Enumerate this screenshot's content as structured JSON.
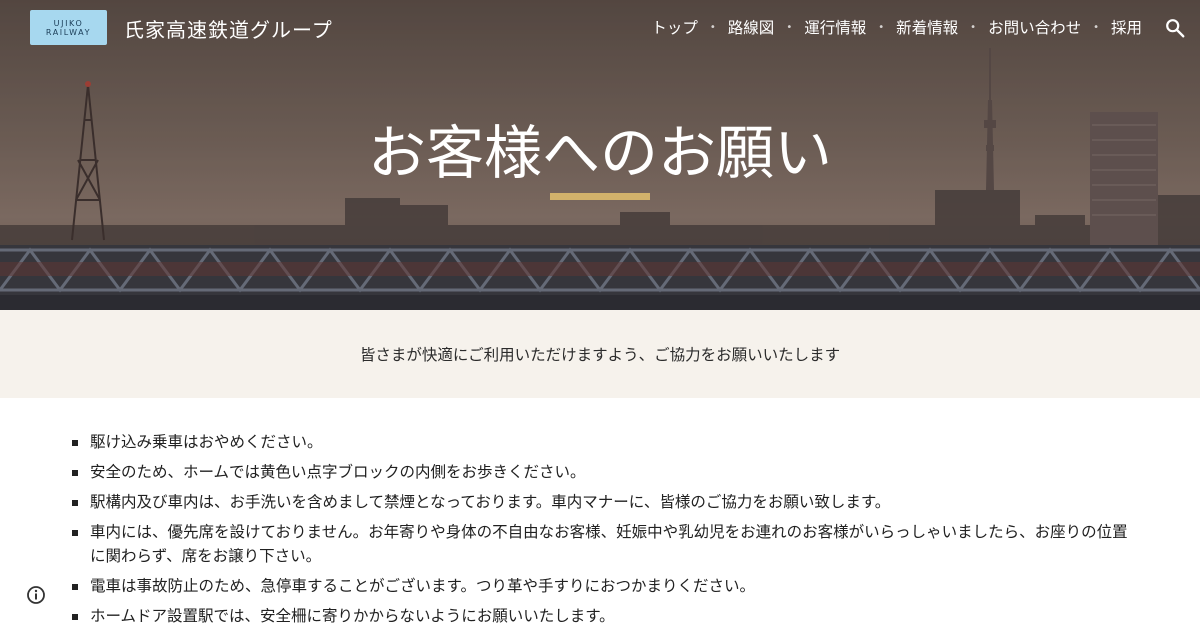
{
  "header": {
    "logo_line1": "UJIKO",
    "logo_line2": "RAILWAY",
    "site_title": "氏家高速鉄道グループ",
    "nav": [
      {
        "label": "トップ"
      },
      {
        "label": "路線図"
      },
      {
        "label": "運行情報"
      },
      {
        "label": "新着情報"
      },
      {
        "label": "お問い合わせ"
      },
      {
        "label": "採用"
      }
    ],
    "search_icon": "search-icon"
  },
  "hero": {
    "title": "お客様へのお願い",
    "accent_color": "#d2b26b"
  },
  "intro": {
    "text": "皆さまが快適にご利用いただけますよう、ご協力をお願いいたします"
  },
  "notices": [
    "駆け込み乗車はおやめください。",
    "安全のため、ホームでは黄色い点字ブロックの内側をお歩きください。",
    "駅構内及び車内は、お手洗いを含めまして禁煙となっております。車内マナーに、皆様のご協力をお願い致します。",
    "車内には、優先席を設けておりません。お年寄りや身体の不自由なお客様、妊娠中や乳幼児をお連れのお客様がいらっしゃいましたら、お座りの位置に関わらず、席をお譲り下さい。",
    "電車は事故防止のため、急停車することがございます。つり革や手すりにおつかまりください。",
    "ホームドア設置駅では、安全柵に寄りかからないようにお願いいたします。"
  ],
  "footer": {
    "info_icon": "info-icon"
  }
}
